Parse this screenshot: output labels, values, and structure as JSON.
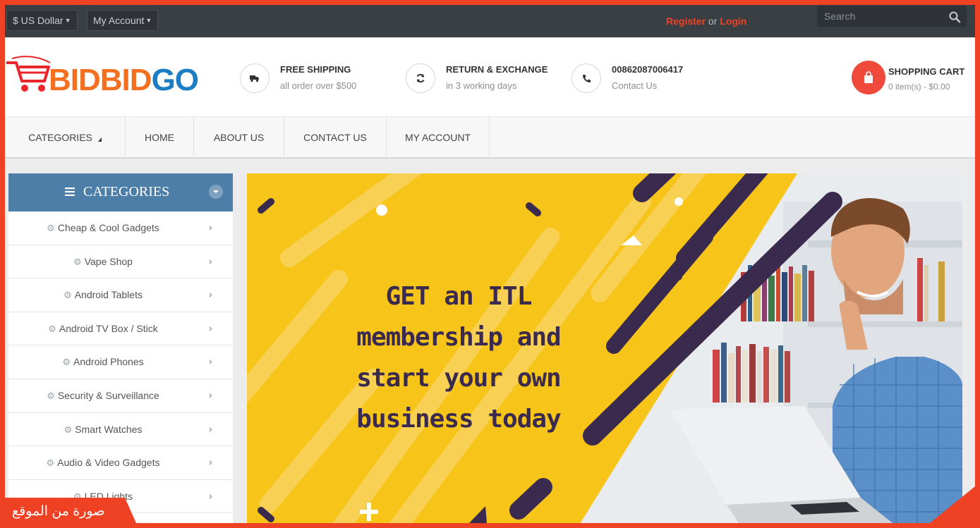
{
  "topbar": {
    "currency_label": "$ US Dollar",
    "account_label": "My Account",
    "register_label": "Register",
    "or_text": "or",
    "login_label": "Login",
    "search_placeholder": "Search"
  },
  "header": {
    "logo_text_1": "BIDBID",
    "logo_text_2": "GO",
    "features": [
      {
        "title": "FREE SHIPPING",
        "subtitle": "all order over $500",
        "icon": "truck-icon"
      },
      {
        "title": "RETURN & EXCHANGE",
        "subtitle": "in 3 working days",
        "icon": "refresh-icon"
      },
      {
        "title": "00862087006417",
        "subtitle": "Contact Us",
        "icon": "phone-icon"
      }
    ],
    "cart": {
      "title": "SHOPPING CART",
      "subtitle": "0 item(s) - $0.00",
      "icon": "shopping-bag-icon"
    }
  },
  "nav": {
    "items": [
      "CATEGORIES",
      "HOME",
      "ABOUT US",
      "CONTACT US",
      "MY ACCOUNT"
    ]
  },
  "sidebar": {
    "title": "CATEGORIES",
    "items": [
      "Cheap & Cool Gadgets",
      "Vape Shop",
      "Android Tablets",
      "Android TV Box / Stick",
      "Android Phones",
      "Security & Surveillance",
      "Smart Watches",
      "Audio & Video Gadgets",
      "LED Lights"
    ]
  },
  "banner": {
    "lines": [
      "GET an ITL",
      "membership and",
      "start your own",
      "business today"
    ]
  },
  "watermark": {
    "text": "صورة من الموقع"
  },
  "colors": {
    "accent": "#ef4123",
    "topbar": "#3a3f44",
    "sidebar_header": "#4d7ea8",
    "banner_yellow": "#f7c41a",
    "banner_purple": "#3a2a4e"
  }
}
